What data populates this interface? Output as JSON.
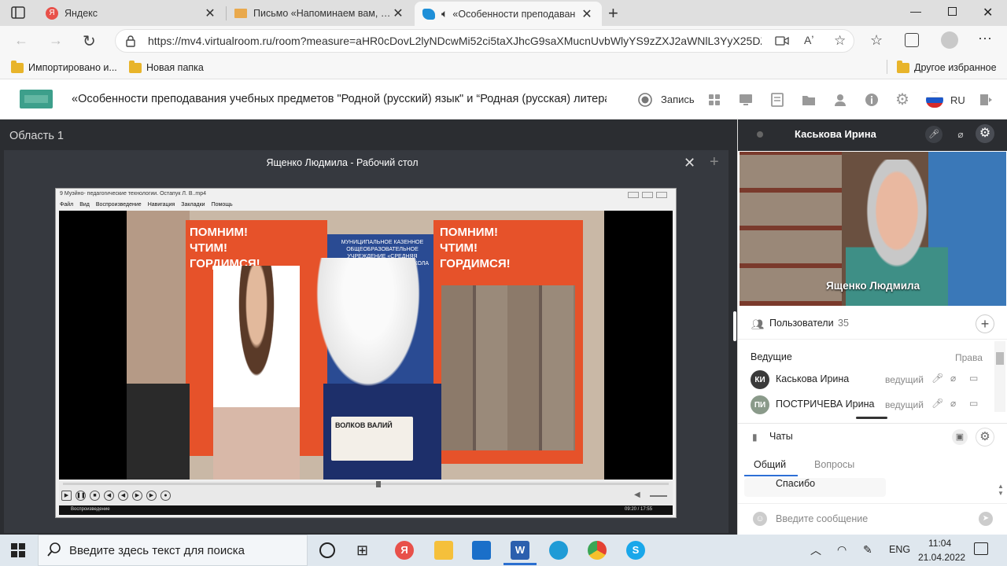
{
  "browser": {
    "tabs": [
      {
        "title": "Яндекс"
      },
      {
        "title": "Письмо «Напоминаем вам, что"
      },
      {
        "title": "«Особенности преподаван"
      }
    ],
    "url": "https://mv4.virtualroom.ru/room?measure=aHR0cDovL2lyNDcwMi52ci5taXJhcG9saXMucnUvbWlyYS9zZXJ2aWNlL3YyX25DZ...",
    "bookmarks": [
      "Импортировано и...",
      "Новая папка"
    ],
    "other_bookmarks": "Другое избранное"
  },
  "app": {
    "room_title": "«Особенности преподавания учебных предметов \"Родной (русский) язык\" и “Родная (русская) литера...",
    "record_label": "Запись",
    "lang": "RU"
  },
  "area": {
    "title": "Область 1",
    "desktop_title": "Ященко Людмила - Рабочий стол"
  },
  "player": {
    "title": "9 Муэйно- педагогические технологии. Остапук Л. В..mp4",
    "menu": [
      "Файл",
      "Вид",
      "Воспроизведение",
      "Навигация",
      "Закладки",
      "Помощь"
    ],
    "status_left": "Воспроизведение",
    "status_time": "09:20 / 17:55",
    "poster_text": "ПОМНИМ! ЧТИМ! ГОРДИМСЯ!",
    "school_text": "МУНИЦИПАЛЬНОЕ КАЗЕННОЕ ОБЩЕОБРАЗОВАТЕЛЬНОЕ УЧРЕЖДЕНИЕ «СРЕДНЯЯ ОБЩЕОБРАЗОВАТЕЛЬНАЯ ШКОЛА",
    "sign_text": "ВОЛКОВ ВАЛИЙ"
  },
  "sidebar": {
    "speaker_name": "Каськова Ирина",
    "camera_name": "Ященко Людмила",
    "users_label": "Пользователи",
    "users_count": "35",
    "hosts_label": "Ведущие",
    "rights_label": "Права",
    "users": [
      {
        "initials": "КИ",
        "name": "Каськова Ирина",
        "role": "ведущий",
        "color": "#3a3a3a"
      },
      {
        "initials": "ПИ",
        "name": "ПОСТРИЧЕВА Ирина",
        "role": "ведущий",
        "color": "#8a9a8a"
      }
    ],
    "chats_label": "Чаты",
    "chat_tabs": [
      "Общий",
      "Вопросы"
    ],
    "last_message": "Спасибо",
    "message_placeholder": "Введите сообщение"
  },
  "taskbar": {
    "search_placeholder": "Введите здесь текст для поиска",
    "lang": "ENG",
    "time": "11:04",
    "date": "21.04.2022"
  }
}
